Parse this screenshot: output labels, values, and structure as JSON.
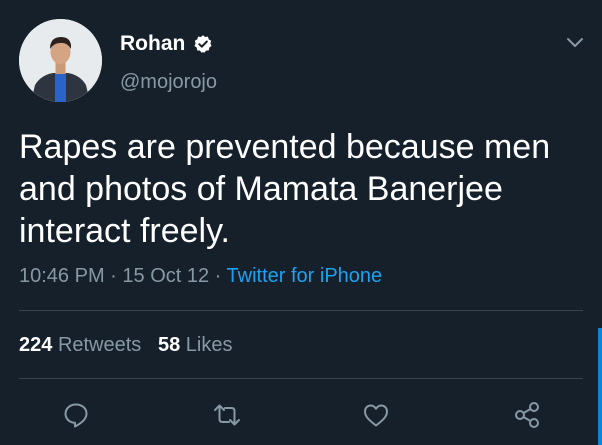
{
  "user": {
    "name": "Rohan",
    "handle": "@mojorojo"
  },
  "tweet": {
    "text": "Rapes are prevented because men and photos of Mamata Banerjee interact freely.",
    "time": "10:46 PM",
    "date": "15 Oct 12",
    "source": "Twitter for iPhone"
  },
  "stats": {
    "retweets_count": "224",
    "retweets_label": "Retweets",
    "likes_count": "58",
    "likes_label": "Likes"
  },
  "colors": {
    "background": "#15202b",
    "secondary_text": "#8899a6",
    "accent": "#1da1f2",
    "divider": "#38444d"
  }
}
